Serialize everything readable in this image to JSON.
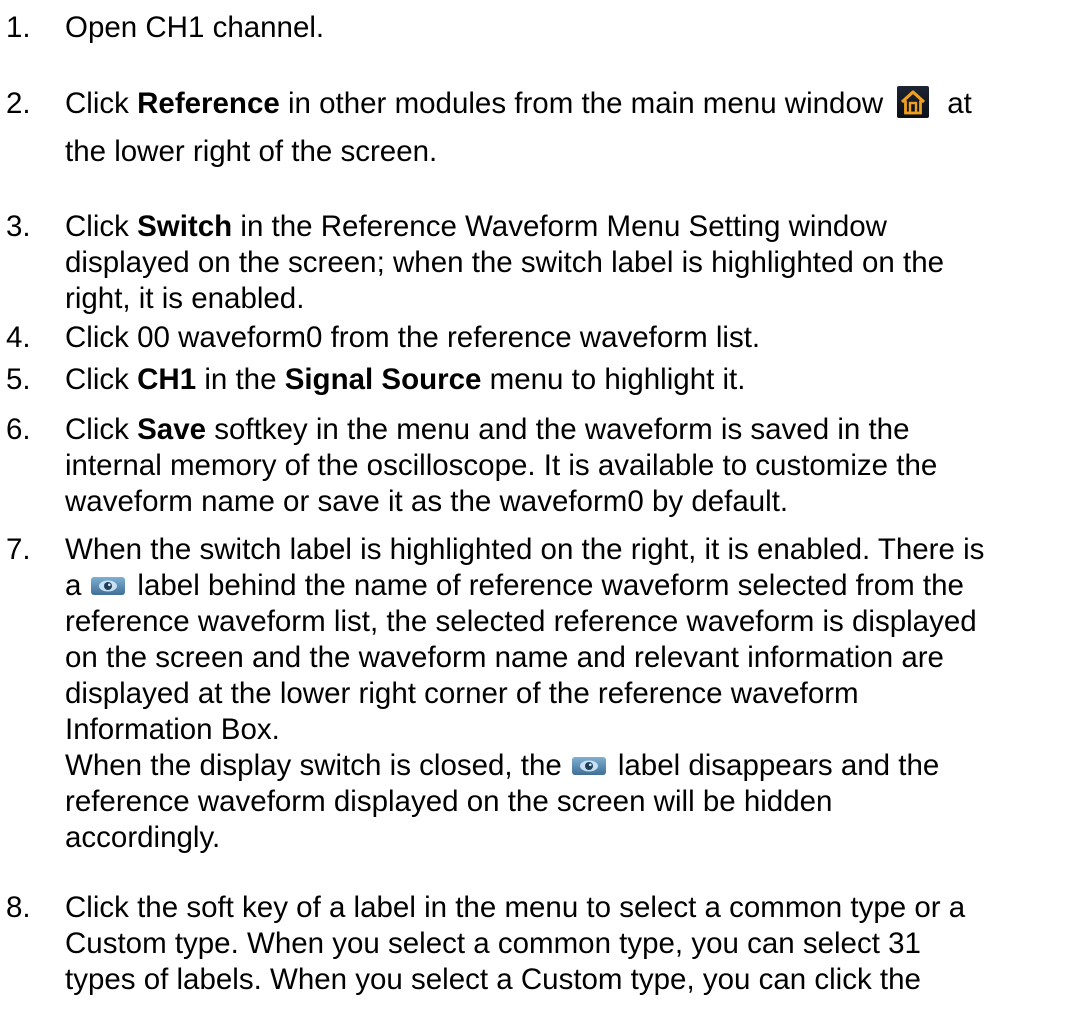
{
  "steps": [
    {
      "num": "1.",
      "line1": "Open CH1 channel."
    },
    {
      "num": "2.",
      "a": "Click ",
      "b": "Reference",
      "c": " in other modules from the main menu window",
      "d": "at",
      "line2": "the lower right of the screen.",
      "icon": "home-icon"
    },
    {
      "num": "3.",
      "a": "Click ",
      "b": "Switch",
      "c": " in the Reference Waveform Menu Setting window",
      "line2": "displayed on the screen; when the switch label is highlighted on the",
      "line3": "right, it is enabled."
    },
    {
      "num": "4.",
      "line1": "Click 00 waveform0 from the reference waveform list."
    },
    {
      "num": "5.",
      "a": "Click ",
      "b": "CH1",
      "c": " in the ",
      "d": "Signal Source",
      "e": " menu to highlight it."
    },
    {
      "num": "6.",
      "a": "Click ",
      "b": "Save",
      "c": " softkey in the menu and the waveform is saved in the",
      "line2": "internal memory of the oscilloscope. It is available to customize the",
      "line3": "waveform name or save it as the waveform0 by default."
    },
    {
      "num": "7.",
      "line1": "When the switch label is highlighted on the right, it is enabled. There is",
      "line2a": "a",
      "line2b": "label behind the name of reference waveform selected from the",
      "line3": "reference waveform list, the selected reference waveform is displayed",
      "line4": "on the screen and the waveform name and relevant information are",
      "line5": "displayed at the lower right corner of the reference waveform",
      "line6": "Information Box.",
      "line7a": "When the display switch is closed, the",
      "line7b": "label disappears and the",
      "line8": "reference waveform displayed on the screen will be hidden",
      "line9": "accordingly.",
      "icon": "eye-icon"
    },
    {
      "num": "8.",
      "line1": "Click the soft key of a label in the menu to select a common type or a",
      "line2": "Custom type. When you select a common type, you can select 31",
      "line3": "types of labels. When you select a Custom type, you can click the"
    }
  ],
  "colors": {
    "home_icon_bg": "#141a26",
    "home_icon_fg": "#f0a020",
    "eye_icon_bg": "#5a8db5"
  }
}
